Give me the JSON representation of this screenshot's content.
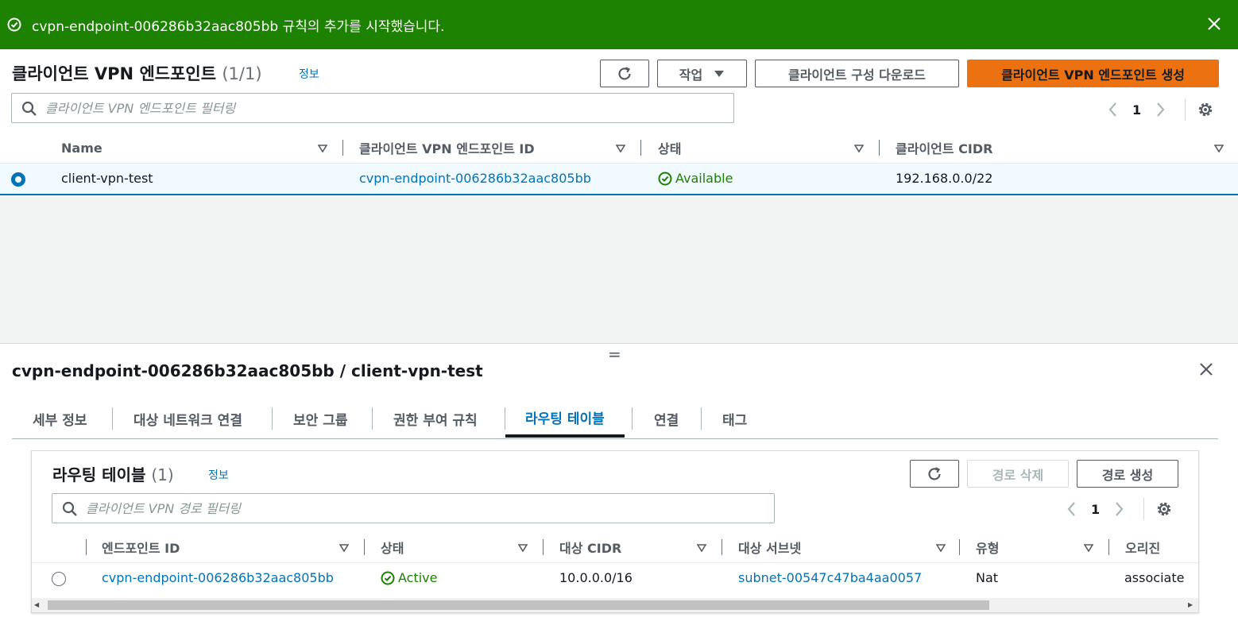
{
  "flash": {
    "message": "cvpn-endpoint-006286b32aac805bb 규칙의 추가를 시작했습니다.",
    "color": "#1d8102",
    "icons": {
      "status": "check-circle-icon",
      "dismiss": "close-icon"
    }
  },
  "endpoints_panel": {
    "title": "클라이언트 VPN 엔드포인트",
    "count": "(1/1)",
    "info_link": "정보",
    "buttons": {
      "refresh_icon": "refresh-icon",
      "actions": "작업",
      "download_config": "클라이언트 구성 다운로드",
      "create": "클라이언트 VPN 엔드포인트 생성"
    },
    "search": {
      "placeholder": "클라이언트 VPN 엔드포인트 필터링",
      "value": ""
    },
    "pagination": {
      "current_page": "1"
    },
    "columns": [
      "Name",
      "클라이언트 VPN 엔드포인트 ID",
      "상태",
      "클라이언트 CIDR"
    ],
    "rows": [
      {
        "selected": true,
        "name": "client-vpn-test",
        "endpoint_id": "cvpn-endpoint-006286b32aac805bb",
        "status": "Available",
        "cidr": "192.168.0.0/22"
      }
    ]
  },
  "split_panel": {
    "handle": "=",
    "title": "cvpn-endpoint-006286b32aac805bb / client-vpn-test",
    "tabs": [
      "세부 정보",
      "대상 네트워크 연결",
      "보안 그룹",
      "권한 부여 규칙",
      "라우팅 테이블",
      "연결",
      "태그"
    ],
    "active_tab": "라우팅 테이블"
  },
  "routes_panel": {
    "title": "라우팅 테이블",
    "count": "(1)",
    "info_link": "정보",
    "buttons": {
      "refresh_icon": "refresh-icon",
      "delete_route": "경로 삭제",
      "create_route": "경로 생성"
    },
    "search": {
      "placeholder": "클라이언트 VPN 경로 필터링",
      "value": ""
    },
    "pagination": {
      "current_page": "1"
    },
    "columns": [
      "엔드포인트 ID",
      "상태",
      "대상 CIDR",
      "대상 서브넷",
      "유형",
      "오리진"
    ],
    "rows": [
      {
        "selected": false,
        "endpoint_id": "cvpn-endpoint-006286b32aac805bb",
        "status": "Active",
        "destination_cidr": "10.0.0.0/16",
        "target_subnet": "subnet-00547c47ba4aa0057",
        "type": "Nat",
        "origin": "associate"
      }
    ]
  },
  "colors": {
    "primary_button": "#ec7211",
    "link": "#0073bb",
    "success": "#1d8102",
    "selected_row": "#f1faff"
  }
}
